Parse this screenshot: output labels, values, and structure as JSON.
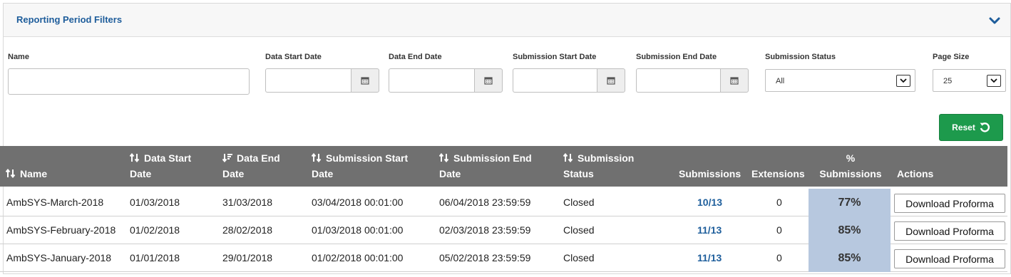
{
  "panel": {
    "title": "Reporting Period Filters"
  },
  "filters": {
    "name_label": "Name",
    "data_start_label": "Data Start Date",
    "data_end_label": "Data End Date",
    "submission_start_label": "Submission Start Date",
    "submission_end_label": "Submission End Date",
    "status_label": "Submission Status",
    "status_value": "All",
    "page_size_label": "Page Size",
    "page_size_value": "25",
    "reset_label": "Reset"
  },
  "table": {
    "headers": {
      "name": "Name",
      "data_start_1": "Data Start",
      "data_start_2": "Date",
      "data_end_1": "Data End",
      "data_end_2": "Date",
      "sub_start_1": "Submission Start",
      "sub_start_2": "Date",
      "sub_end_1": "Submission End",
      "sub_end_2": "Date",
      "status_1": "Submission",
      "status_2": "Status",
      "submissions": "Submissions",
      "extensions": "Extensions",
      "pct_1": "%",
      "pct_2": "Submissions",
      "actions": "Actions"
    },
    "rows": [
      {
        "name": "AmbSYS-March-2018",
        "data_start": "01/03/2018",
        "data_end": "31/03/2018",
        "sub_start": "03/04/2018 00:01:00",
        "sub_end": "06/04/2018 23:59:59",
        "status": "Closed",
        "submissions": "10/13",
        "extensions": "0",
        "pct": "77%",
        "action": "Download Proforma"
      },
      {
        "name": "AmbSYS-February-2018",
        "data_start": "01/02/2018",
        "data_end": "28/02/2018",
        "sub_start": "01/03/2018 00:01:00",
        "sub_end": "02/03/2018 23:59:59",
        "status": "Closed",
        "submissions": "11/13",
        "extensions": "0",
        "pct": "85%",
        "action": "Download Proforma"
      },
      {
        "name": "AmbSYS-January-2018",
        "data_start": "01/01/2018",
        "data_end": "29/01/2018",
        "sub_start": "01/02/2018 00:01:00",
        "sub_end": "05/02/2018 23:59:59",
        "status": "Closed",
        "submissions": "11/13",
        "extensions": "0",
        "pct": "85%",
        "action": "Download Proforma"
      }
    ]
  },
  "icons": {
    "collapse": "chevron-down-icon",
    "calendar": "calendar-icon",
    "sort": "sort-icon",
    "reset": "refresh-icon",
    "select": "select-arrow-icon"
  },
  "colors": {
    "accent": "#1e5d9b",
    "reset_green": "#1d9a4c",
    "header_gray": "#707070",
    "pct_cell": "#b7c8df"
  }
}
